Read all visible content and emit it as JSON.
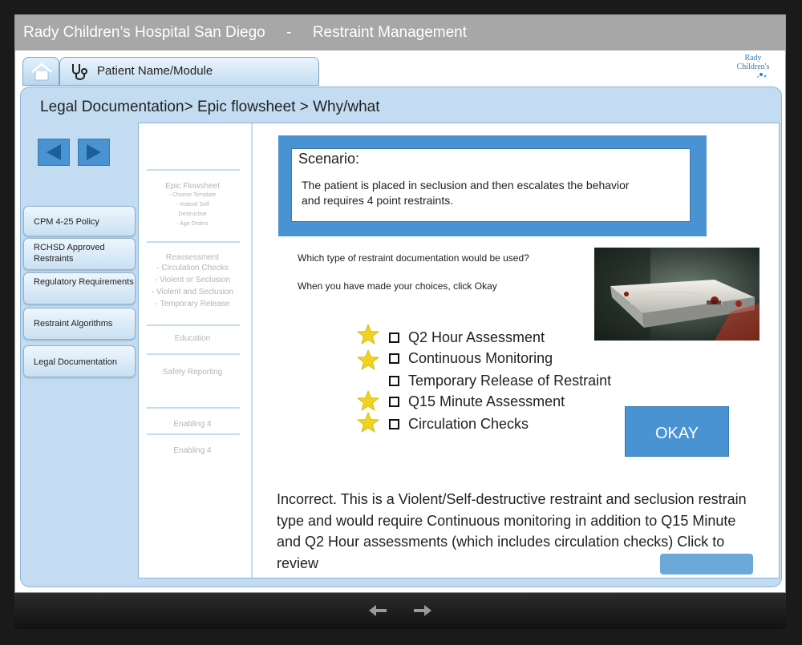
{
  "window": {
    "title": "Rady Children’s Hospital San Diego     -     Restraint Management"
  },
  "header": {
    "home_icon": "home-icon",
    "patient_tab_icon": "stethoscope-icon",
    "patient_tab_label": "Patient Name/Module",
    "logo_line1": "Rady",
    "logo_line2": "Children's"
  },
  "breadcrumb": "Legal Documentation> Epic flowsheet > Why/what",
  "nav_arrows": {
    "back_icon": "triangle-left-icon",
    "forward_icon": "triangle-right-icon"
  },
  "sidebar": {
    "items": [
      {
        "label": "CPM 4-25 Policy"
      },
      {
        "label": "RCHSD Approved Restraints"
      },
      {
        "label": "Regulatory Requirements"
      },
      {
        "label": "Restraint Algorithms"
      },
      {
        "label": "Legal Documentation"
      }
    ]
  },
  "module_nav": {
    "epic_title": "Epic Flowsheet",
    "epic_sub1": "- Choose Template",
    "epic_sub2": "-     Violent/ Self",
    "epic_sub3": "Destructive",
    "epic_sub4": "-     Age Orders",
    "reassess_title": "Reassessment",
    "reassess_sub1": "-  Circulation Checks",
    "reassess_sub2": "-  Violent or Seclusion",
    "reassess_sub3": "-  Violent and Seclusion",
    "reassess_sub4": "-  Temporary Release",
    "education": "Education",
    "safety": "Safety Reporting",
    "enabling1": "Enabling 4",
    "enabling2": "Enabling 4"
  },
  "scenario": {
    "title": "Scenario:",
    "text": "The patient is placed in seclusion and then escalates the behavior and requires 4 point restraints."
  },
  "question": {
    "line1": "Which type of restraint documentation would be used?",
    "line2": "When you have made your choices, click Okay"
  },
  "photo_subject": "seclusion-room-bed",
  "options": [
    {
      "label": "Q2 Hour Assessment",
      "starred": true
    },
    {
      "label": "Continuous Monitoring",
      "starred": true
    },
    {
      "label": "Temporary Release of Restraint",
      "starred": false
    },
    {
      "label": "Q15 Minute Assessment",
      "starred": true
    },
    {
      "label": "Circulation Checks",
      "starred": true
    }
  ],
  "okay_button": "OKAY",
  "feedback": "Incorrect. This is a Violent/Self-destructive restraint and seclusion restrain type and would require Continuous monitoring in addition to Q15 Minute and Q2 Hour assessments (which includes circulation checks)  Click to review",
  "player": {
    "prev_icon": "arrow-left-icon",
    "next_icon": "arrow-right-icon"
  },
  "colors": {
    "title_bar": "#a7a7a7",
    "panel": "#c3dcf1",
    "accent": "#4a93d2",
    "star": "#f2d21e"
  }
}
